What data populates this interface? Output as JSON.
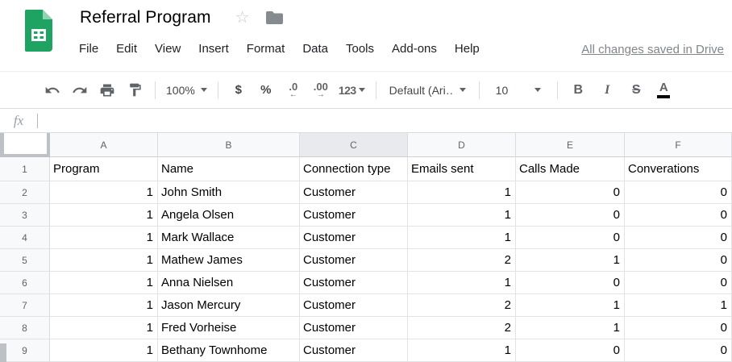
{
  "header": {
    "title": "Referral Program",
    "menus": [
      "File",
      "Edit",
      "View",
      "Insert",
      "Format",
      "Data",
      "Tools",
      "Add-ons",
      "Help"
    ],
    "saved_status": "All changes saved in Drive",
    "icons": {
      "logo": "sheets-logo",
      "star": "star-outline-icon",
      "folder": "folder-icon"
    }
  },
  "toolbar": {
    "zoom_level": "100%",
    "currency_label": "$",
    "percent_label": "%",
    "decrease_decimal_label": ".0",
    "decrease_decimal_arrow": "←",
    "increase_decimal_label": ".00",
    "increase_decimal_arrow": "→",
    "number_format_label": "123",
    "font_name": "Default (Ari…",
    "font_size": "10",
    "bold_label": "B",
    "italic_label": "I",
    "strikethrough_label": "S",
    "text_color_label": "A",
    "icons": [
      "undo-icon",
      "redo-icon",
      "print-icon",
      "paint-format-icon"
    ],
    "text_color_bar": "#000000"
  },
  "formula_bar": {
    "fx_label": "fx",
    "input_value": ""
  },
  "grid": {
    "column_letters": [
      "A",
      "B",
      "C",
      "D",
      "E",
      "F"
    ],
    "selected_column": "C",
    "rows": [
      {
        "n": "1",
        "cells": [
          "Program",
          "Name",
          "Connection type",
          "Emails sent",
          "Calls Made",
          "Converations"
        ]
      },
      {
        "n": "2",
        "cells": [
          "1",
          "John Smith",
          "Customer",
          "1",
          "0",
          "0"
        ]
      },
      {
        "n": "3",
        "cells": [
          "1",
          "Angela Olsen",
          "Customer",
          "1",
          "0",
          "0"
        ]
      },
      {
        "n": "4",
        "cells": [
          "1",
          "Mark Wallace",
          "Customer",
          "1",
          "0",
          "0"
        ]
      },
      {
        "n": "5",
        "cells": [
          "1",
          "Mathew James",
          "Customer",
          "2",
          "1",
          "0"
        ]
      },
      {
        "n": "6",
        "cells": [
          "1",
          "Anna Nielsen",
          "Customer",
          "1",
          "0",
          "0"
        ]
      },
      {
        "n": "7",
        "cells": [
          "1",
          "Jason Mercury",
          "Customer",
          "2",
          "1",
          "1"
        ]
      },
      {
        "n": "8",
        "cells": [
          "1",
          "Fred Vorheise",
          "Customer",
          "2",
          "1",
          "0"
        ]
      },
      {
        "n": "9",
        "cells": [
          "1",
          "Bethany Townhome",
          "Customer",
          "1",
          "0",
          "0"
        ]
      }
    ]
  },
  "colors": {
    "logo_green": "#1ea362",
    "logo_fold": "#8fd3af",
    "selected_header_bg": "#e8eaed",
    "header_bg": "#f8f9fa",
    "grid_line": "#e1e3e4",
    "saved_text": "#80868b"
  }
}
